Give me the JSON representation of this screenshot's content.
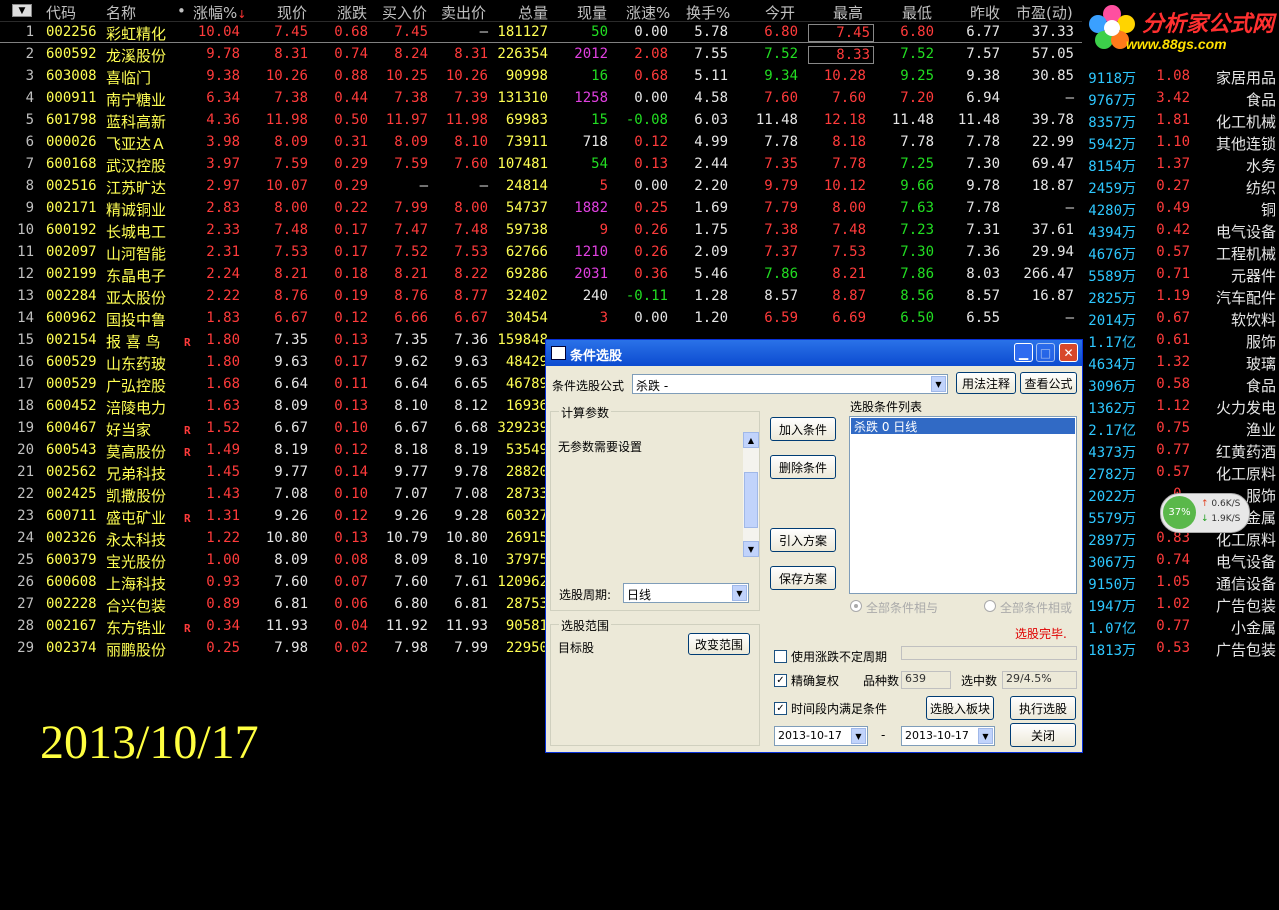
{
  "header": {
    "menu_glyph": "▼",
    "columns": [
      "代码",
      "名称",
      "•",
      "涨幅%",
      "现价",
      "涨跌",
      "买入价",
      "卖出价",
      "总量",
      "现量",
      "涨速%",
      "换手%",
      "今开",
      "最高",
      "最低",
      "昨收",
      "市盈(动)"
    ],
    "sort_arrow": "↓"
  },
  "rows": [
    {
      "no": "1",
      "code": "002256",
      "name": "彩虹精化",
      "mark": "",
      "chg_pct": "10.04",
      "price": "7.45",
      "chg": "0.68",
      "bid": "7.45",
      "ask": "—",
      "vol": "181127",
      "cur_vol": "50",
      "speed": "0.00",
      "turnover": "5.78",
      "open": "6.80",
      "high": "7.45",
      "low": "6.80",
      "prev": "6.77",
      "pe": "37.33",
      "cap": "",
      "extra": "",
      "industry": ""
    },
    {
      "no": "2",
      "code": "600592",
      "name": "龙溪股份",
      "mark": "",
      "chg_pct": "9.78",
      "price": "8.31",
      "chg": "0.74",
      "bid": "8.24",
      "ask": "8.31",
      "vol": "226354",
      "cur_vol": "2012",
      "speed": "2.08",
      "turnover": "7.55",
      "open": "7.52",
      "high": "8.33",
      "low": "7.52",
      "prev": "7.57",
      "pe": "57.05",
      "cap": "",
      "extra": "",
      "industry": ""
    },
    {
      "no": "3",
      "code": "603008",
      "name": "喜临门",
      "mark": "",
      "chg_pct": "9.38",
      "price": "10.26",
      "chg": "0.88",
      "bid": "10.25",
      "ask": "10.26",
      "vol": "90998",
      "cur_vol": "16",
      "speed": "0.68",
      "turnover": "5.11",
      "open": "9.34",
      "high": "10.28",
      "low": "9.25",
      "prev": "9.38",
      "pe": "30.85",
      "cap": "9118万",
      "extra": "1.08",
      "industry": "家居用品"
    },
    {
      "no": "4",
      "code": "000911",
      "name": "南宁糖业",
      "mark": "",
      "chg_pct": "6.34",
      "price": "7.38",
      "chg": "0.44",
      "bid": "7.38",
      "ask": "7.39",
      "vol": "131310",
      "cur_vol": "1258",
      "speed": "0.00",
      "turnover": "4.58",
      "open": "7.60",
      "high": "7.60",
      "low": "7.20",
      "prev": "6.94",
      "pe": "—",
      "cap": "9767万",
      "extra": "3.42",
      "industry": "食品"
    },
    {
      "no": "5",
      "code": "601798",
      "name": "蓝科高新",
      "mark": "",
      "chg_pct": "4.36",
      "price": "11.98",
      "chg": "0.50",
      "bid": "11.97",
      "ask": "11.98",
      "vol": "69983",
      "cur_vol": "15",
      "speed": "-0.08",
      "turnover": "6.03",
      "open": "11.48",
      "high": "12.18",
      "low": "11.48",
      "prev": "11.48",
      "pe": "39.78",
      "cap": "8357万",
      "extra": "1.81",
      "industry": "化工机械"
    },
    {
      "no": "6",
      "code": "000026",
      "name": "飞亚达Ａ",
      "mark": "",
      "chg_pct": "3.98",
      "price": "8.09",
      "chg": "0.31",
      "bid": "8.09",
      "ask": "8.10",
      "vol": "73911",
      "cur_vol": "718",
      "speed": "0.12",
      "turnover": "4.99",
      "open": "7.78",
      "high": "8.18",
      "low": "7.78",
      "prev": "7.78",
      "pe": "22.99",
      "cap": "5942万",
      "extra": "1.10",
      "industry": "其他连锁"
    },
    {
      "no": "7",
      "code": "600168",
      "name": "武汉控股",
      "mark": "",
      "chg_pct": "3.97",
      "price": "7.59",
      "chg": "0.29",
      "bid": "7.59",
      "ask": "7.60",
      "vol": "107481",
      "cur_vol": "54",
      "speed": "0.13",
      "turnover": "2.44",
      "open": "7.35",
      "high": "7.78",
      "low": "7.25",
      "prev": "7.30",
      "pe": "69.47",
      "cap": "8154万",
      "extra": "1.37",
      "industry": "水务"
    },
    {
      "no": "8",
      "code": "002516",
      "name": "江苏旷达",
      "mark": "",
      "chg_pct": "2.97",
      "price": "10.07",
      "chg": "0.29",
      "bid": "—",
      "ask": "—",
      "vol": "24814",
      "cur_vol": "5",
      "speed": "0.00",
      "turnover": "2.20",
      "open": "9.79",
      "high": "10.12",
      "low": "9.66",
      "prev": "9.78",
      "pe": "18.87",
      "cap": "2459万",
      "extra": "0.27",
      "industry": "纺织"
    },
    {
      "no": "9",
      "code": "002171",
      "name": "精诚铜业",
      "mark": "",
      "chg_pct": "2.83",
      "price": "8.00",
      "chg": "0.22",
      "bid": "7.99",
      "ask": "8.00",
      "vol": "54737",
      "cur_vol": "1882",
      "speed": "0.25",
      "turnover": "1.69",
      "open": "7.79",
      "high": "8.00",
      "low": "7.63",
      "prev": "7.78",
      "pe": "—",
      "cap": "4280万",
      "extra": "0.49",
      "industry": "铜"
    },
    {
      "no": "10",
      "code": "600192",
      "name": "长城电工",
      "mark": "",
      "chg_pct": "2.33",
      "price": "7.48",
      "chg": "0.17",
      "bid": "7.47",
      "ask": "7.48",
      "vol": "59738",
      "cur_vol": "9",
      "speed": "0.26",
      "turnover": "1.75",
      "open": "7.38",
      "high": "7.48",
      "low": "7.23",
      "prev": "7.31",
      "pe": "37.61",
      "cap": "4394万",
      "extra": "0.42",
      "industry": "电气设备"
    },
    {
      "no": "11",
      "code": "002097",
      "name": "山河智能",
      "mark": "",
      "chg_pct": "2.31",
      "price": "7.53",
      "chg": "0.17",
      "bid": "7.52",
      "ask": "7.53",
      "vol": "62766",
      "cur_vol": "1210",
      "speed": "0.26",
      "turnover": "2.09",
      "open": "7.37",
      "high": "7.53",
      "low": "7.30",
      "prev": "7.36",
      "pe": "29.94",
      "cap": "4676万",
      "extra": "0.57",
      "industry": "工程机械"
    },
    {
      "no": "12",
      "code": "002199",
      "name": "东晶电子",
      "mark": "",
      "chg_pct": "2.24",
      "price": "8.21",
      "chg": "0.18",
      "bid": "8.21",
      "ask": "8.22",
      "vol": "69286",
      "cur_vol": "2031",
      "speed": "0.36",
      "turnover": "5.46",
      "open": "7.86",
      "high": "8.21",
      "low": "7.86",
      "prev": "8.03",
      "pe": "266.47",
      "cap": "5589万",
      "extra": "0.71",
      "industry": "元器件"
    },
    {
      "no": "13",
      "code": "002284",
      "name": "亚太股份",
      "mark": "",
      "chg_pct": "2.22",
      "price": "8.76",
      "chg": "0.19",
      "bid": "8.76",
      "ask": "8.77",
      "vol": "32402",
      "cur_vol": "240",
      "speed": "-0.11",
      "turnover": "1.28",
      "open": "8.57",
      "high": "8.87",
      "low": "8.56",
      "prev": "8.57",
      "pe": "16.87",
      "cap": "2825万",
      "extra": "1.19",
      "industry": "汽车配件"
    },
    {
      "no": "14",
      "code": "600962",
      "name": "国投中鲁",
      "mark": "",
      "chg_pct": "1.83",
      "price": "6.67",
      "chg": "0.12",
      "bid": "6.66",
      "ask": "6.67",
      "vol": "30454",
      "cur_vol": "3",
      "speed": "0.00",
      "turnover": "1.20",
      "open": "6.59",
      "high": "6.69",
      "low": "6.50",
      "prev": "6.55",
      "pe": "—",
      "cap": "2014万",
      "extra": "0.67",
      "industry": "软饮料"
    },
    {
      "no": "15",
      "code": "002154",
      "name": "报 喜 鸟",
      "mark": "R",
      "chg_pct": "1.80",
      "price": "7.35",
      "chg": "0.13",
      "bid": "7.35",
      "ask": "7.36",
      "vol": "159848",
      "cur_vol": "",
      "speed": "",
      "turnover": "",
      "open": "",
      "high": "",
      "low": "",
      "prev": "",
      "pe": "",
      "cap": "1.17亿",
      "extra": "0.61",
      "industry": "服饰"
    },
    {
      "no": "16",
      "code": "600529",
      "name": "山东药玻",
      "mark": "",
      "chg_pct": "1.80",
      "price": "9.63",
      "chg": "0.17",
      "bid": "9.62",
      "ask": "9.63",
      "vol": "48429",
      "cur_vol": "",
      "speed": "",
      "turnover": "",
      "open": "",
      "high": "",
      "low": "",
      "prev": "",
      "pe": "",
      "cap": "4634万",
      "extra": "1.32",
      "industry": "玻璃"
    },
    {
      "no": "17",
      "code": "000529",
      "name": "广弘控股",
      "mark": "",
      "chg_pct": "1.68",
      "price": "6.64",
      "chg": "0.11",
      "bid": "6.64",
      "ask": "6.65",
      "vol": "46789",
      "cur_vol": "",
      "speed": "",
      "turnover": "",
      "open": "",
      "high": "",
      "low": "",
      "prev": "",
      "pe": "",
      "cap": "3096万",
      "extra": "0.58",
      "industry": "食品"
    },
    {
      "no": "18",
      "code": "600452",
      "name": "涪陵电力",
      "mark": "",
      "chg_pct": "1.63",
      "price": "8.09",
      "chg": "0.13",
      "bid": "8.10",
      "ask": "8.12",
      "vol": "16936",
      "cur_vol": "",
      "speed": "",
      "turnover": "",
      "open": "",
      "high": "",
      "low": "",
      "prev": "",
      "pe": "",
      "cap": "1362万",
      "extra": "1.12",
      "industry": "火力发电"
    },
    {
      "no": "19",
      "code": "600467",
      "name": "好当家",
      "mark": "R",
      "chg_pct": "1.52",
      "price": "6.67",
      "chg": "0.10",
      "bid": "6.67",
      "ask": "6.68",
      "vol": "329239",
      "cur_vol": "",
      "speed": "",
      "turnover": "",
      "open": "",
      "high": "",
      "low": "",
      "prev": "",
      "pe": "",
      "cap": "2.17亿",
      "extra": "0.75",
      "industry": "渔业"
    },
    {
      "no": "20",
      "code": "600543",
      "name": "莫高股份",
      "mark": "R",
      "chg_pct": "1.49",
      "price": "8.19",
      "chg": "0.12",
      "bid": "8.18",
      "ask": "8.19",
      "vol": "53549",
      "cur_vol": "",
      "speed": "",
      "turnover": "",
      "open": "",
      "high": "",
      "low": "",
      "prev": "",
      "pe": "",
      "cap": "4373万",
      "extra": "0.77",
      "industry": "红黄药酒"
    },
    {
      "no": "21",
      "code": "002562",
      "name": "兄弟科技",
      "mark": "",
      "chg_pct": "1.45",
      "price": "9.77",
      "chg": "0.14",
      "bid": "9.77",
      "ask": "9.78",
      "vol": "28820",
      "cur_vol": "",
      "speed": "",
      "turnover": "",
      "open": "",
      "high": "",
      "low": "",
      "prev": "",
      "pe": "",
      "cap": "2782万",
      "extra": "0.57",
      "industry": "化工原料"
    },
    {
      "no": "22",
      "code": "002425",
      "name": "凯撒股份",
      "mark": "",
      "chg_pct": "1.43",
      "price": "7.08",
      "chg": "0.10",
      "bid": "7.07",
      "ask": "7.08",
      "vol": "28733",
      "cur_vol": "",
      "speed": "",
      "turnover": "",
      "open": "",
      "high": "",
      "low": "",
      "prev": "",
      "pe": "",
      "cap": "2022万",
      "extra": "0.",
      "industry": "服饰"
    },
    {
      "no": "23",
      "code": "600711",
      "name": "盛屯矿业",
      "mark": "R",
      "chg_pct": "1.31",
      "price": "9.26",
      "chg": "0.12",
      "bid": "9.26",
      "ask": "9.28",
      "vol": "60327",
      "cur_vol": "",
      "speed": "",
      "turnover": "",
      "open": "",
      "high": "",
      "low": "",
      "prev": "",
      "pe": "",
      "cap": "5579万",
      "extra": "",
      "industry": "金属"
    },
    {
      "no": "24",
      "code": "002326",
      "name": "永太科技",
      "mark": "",
      "chg_pct": "1.22",
      "price": "10.80",
      "chg": "0.13",
      "bid": "10.79",
      "ask": "10.80",
      "vol": "26915",
      "cur_vol": "",
      "speed": "",
      "turnover": "",
      "open": "",
      "high": "",
      "low": "",
      "prev": "",
      "pe": "",
      "cap": "2897万",
      "extra": "0.83",
      "industry": "化工原料"
    },
    {
      "no": "25",
      "code": "600379",
      "name": "宝光股份",
      "mark": "",
      "chg_pct": "1.00",
      "price": "8.09",
      "chg": "0.08",
      "bid": "8.09",
      "ask": "8.10",
      "vol": "37975",
      "cur_vol": "",
      "speed": "",
      "turnover": "",
      "open": "",
      "high": "",
      "low": "",
      "prev": "",
      "pe": "",
      "cap": "3067万",
      "extra": "0.74",
      "industry": "电气设备"
    },
    {
      "no": "26",
      "code": "600608",
      "name": "上海科技",
      "mark": "",
      "chg_pct": "0.93",
      "price": "7.60",
      "chg": "0.07",
      "bid": "7.60",
      "ask": "7.61",
      "vol": "120962",
      "cur_vol": "",
      "speed": "",
      "turnover": "",
      "open": "",
      "high": "",
      "low": "",
      "prev": "",
      "pe": "",
      "cap": "9150万",
      "extra": "1.05",
      "industry": "通信设备"
    },
    {
      "no": "27",
      "code": "002228",
      "name": "合兴包装",
      "mark": "",
      "chg_pct": "0.89",
      "price": "6.81",
      "chg": "0.06",
      "bid": "6.80",
      "ask": "6.81",
      "vol": "28753",
      "cur_vol": "",
      "speed": "",
      "turnover": "",
      "open": "",
      "high": "",
      "low": "",
      "prev": "",
      "pe": "",
      "cap": "1947万",
      "extra": "1.02",
      "industry": "广告包装"
    },
    {
      "no": "28",
      "code": "002167",
      "name": "东方锆业",
      "mark": "R",
      "chg_pct": "0.34",
      "price": "11.93",
      "chg": "0.04",
      "bid": "11.92",
      "ask": "11.93",
      "vol": "90581",
      "cur_vol": "",
      "speed": "",
      "turnover": "",
      "open": "",
      "high": "",
      "low": "",
      "prev": "",
      "pe": "",
      "cap": "1.07亿",
      "extra": "0.77",
      "industry": "小金属"
    },
    {
      "no": "29",
      "code": "002374",
      "name": "丽鹏股份",
      "mark": "",
      "chg_pct": "0.25",
      "price": "7.98",
      "chg": "0.02",
      "bid": "7.98",
      "ask": "7.99",
      "vol": "22950",
      "cur_vol": "",
      "speed": "",
      "turnover": "",
      "open": "",
      "high": "",
      "low": "",
      "prev": "",
      "pe": "",
      "cap": "1813万",
      "extra": "0.53",
      "industry": "广告包装"
    }
  ],
  "date_overlay": "2013/10/17",
  "logo": {
    "title": "分析家公式网",
    "url": "www.88gs.com"
  },
  "speed_widget": {
    "percent": "37%",
    "up": "0.6K/S",
    "down": "1.9K/S"
  },
  "dialog": {
    "title": "条件选股",
    "formula_label": "条件选股公式",
    "formula_value": "杀跌      -",
    "usage_btn": "用法注释",
    "view_btn": "查看公式",
    "params_group": "计算参数",
    "params_text": "无参数需要设置",
    "period_label": "选股周期:",
    "period_value": "日线",
    "add_btn": "加入条件",
    "del_btn": "删除条件",
    "import_btn": "引入方案",
    "save_btn": "保存方案",
    "list_label": "选股条件列表",
    "list_items": [
      "杀跌  0  日线"
    ],
    "radio_and": "全部条件相与",
    "radio_or": "全部条件相或",
    "status": "选股完毕.",
    "range_group": "选股范围",
    "range_value": "目标股",
    "change_range_btn": "改变范围",
    "chk_unstable": "使用涨跌不定周期",
    "chk_adjust": "精确复权",
    "count_label": "品种数",
    "count_value": "639",
    "hit_label": "选中数",
    "hit_value": "29/4.5%",
    "chk_period": "时间段内满足条件",
    "to_block_btn": "选股入板块",
    "run_btn": "执行选股",
    "date_from": "2013-10-17",
    "date_sep": "-",
    "date_to": "2013-10-17",
    "close_btn": "关闭"
  }
}
